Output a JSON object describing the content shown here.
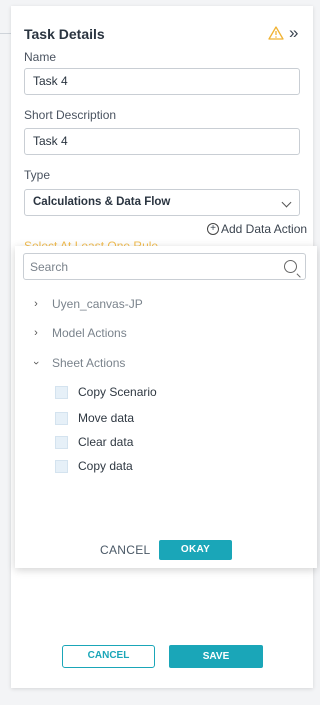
{
  "panel": {
    "title": "Task Details",
    "expand_glyph": "»",
    "icons": {
      "warning": "warning-icon",
      "expand": "double-chevron-right-icon"
    },
    "name_label": "Name",
    "name_value": "Task 4",
    "short_desc_label": "Short Description",
    "short_desc_value": "Task 4",
    "type_label": "Type",
    "type_value": "Calculations & Data Flow",
    "add_action": "Add Data Action",
    "hint": "Select At Least One Rule"
  },
  "dropdown": {
    "search_placeholder": "Search",
    "tree": [
      {
        "label": "Uyen_canvas-JP",
        "expanded": false
      },
      {
        "label": "Model Actions",
        "expanded": false
      },
      {
        "label": "Sheet Actions",
        "expanded": true
      }
    ],
    "sheet_actions": [
      {
        "label": "Copy Scenario",
        "checked": false
      },
      {
        "label": "Move data",
        "checked": false
      },
      {
        "label": "Clear data",
        "checked": false
      },
      {
        "label": "Copy data",
        "checked": false
      }
    ],
    "cancel_label": "CANCEL",
    "okay_label": "OKAY"
  },
  "footer": {
    "cancel_label": "CANCEL",
    "save_label": "SAVE"
  },
  "colors": {
    "accent": "#1aa6b8",
    "warning": "#f0b232"
  }
}
